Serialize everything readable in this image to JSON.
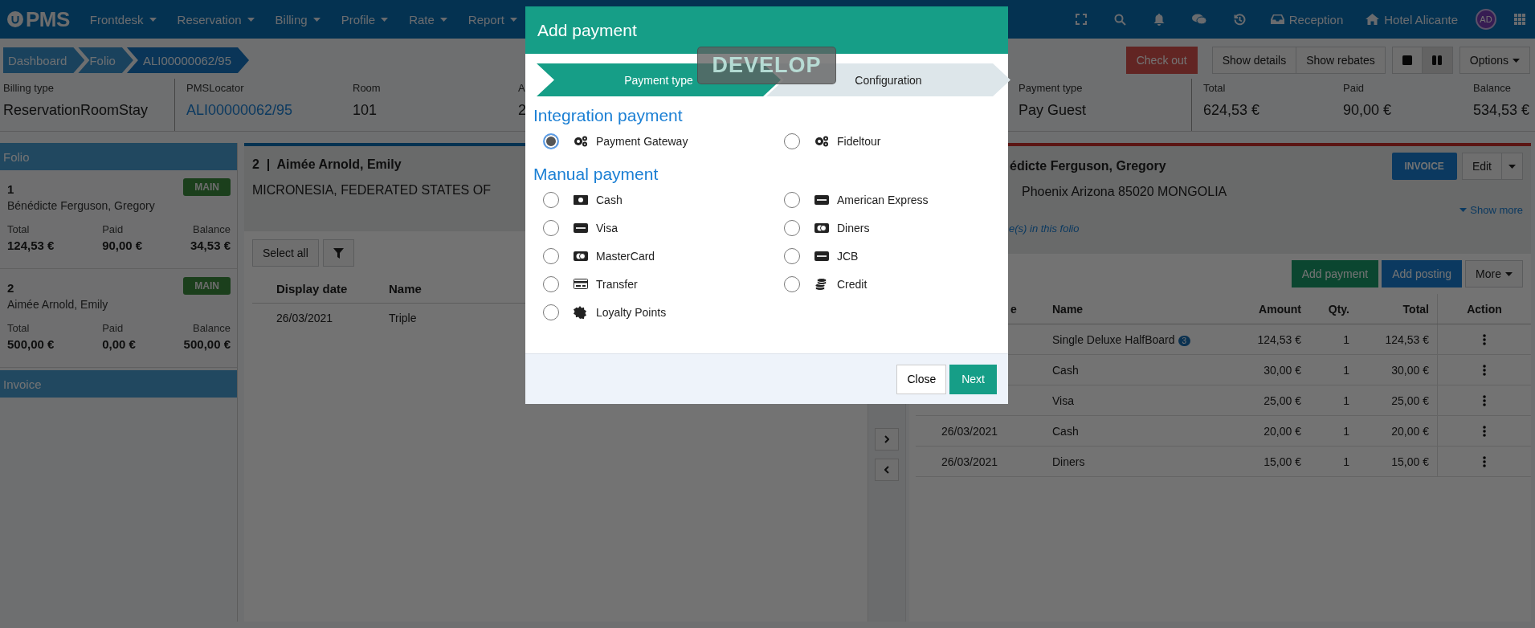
{
  "navbar": {
    "logo": "PMS",
    "menus": [
      "Frontdesk",
      "Reservation",
      "Billing",
      "Profile",
      "Rate",
      "Report"
    ],
    "reception": "Reception",
    "hotel": "Hotel Alicante",
    "avatar": "AD"
  },
  "breadcrumb": [
    {
      "label": "Dashboard",
      "selected": false
    },
    {
      "label": "Folio",
      "selected": false
    },
    {
      "label": "ALI00000062/95",
      "selected": true
    }
  ],
  "actions": {
    "check_out": "Check out",
    "details": [
      "Show details",
      "Show rebates"
    ],
    "views": [
      {
        "kind": "single",
        "selected": false
      },
      {
        "kind": "split",
        "selected": true
      }
    ],
    "options": "Options"
  },
  "summary": {
    "left": [
      {
        "label": "Billing type",
        "value": "ReservationRoomStay",
        "kind": "text"
      },
      {
        "label": "PMSLocator",
        "value": "ALI00000062/95",
        "kind": "link"
      },
      {
        "label": "Room",
        "value": "101",
        "kind": "text"
      },
      {
        "label": "A",
        "value": "2",
        "kind": "text"
      }
    ],
    "right": [
      {
        "label": "Payment type",
        "value": "Pay Guest",
        "kind": "text"
      },
      {
        "label": "Total",
        "value": "624,53 €",
        "kind": "text"
      },
      {
        "label": "Paid",
        "value": "90,00 €",
        "kind": "text"
      },
      {
        "label": "Balance",
        "value": "534,53 €",
        "kind": "text"
      }
    ]
  },
  "sidebar": {
    "title": "Folio",
    "folios": [
      {
        "number": "1",
        "name": "Bénédicte Ferguson, Gregory",
        "badge": "MAIN",
        "totals": [
          {
            "label": "Total",
            "value": "124,53 €"
          },
          {
            "label": "Paid",
            "value": "90,00 €"
          },
          {
            "label": "Balance",
            "value": "34,53 €"
          }
        ]
      },
      {
        "number": "2",
        "name": "Aimée Arnold, Emily",
        "badge": "MAIN",
        "totals": [
          {
            "label": "Total",
            "value": "500,00 €"
          },
          {
            "label": "Paid",
            "value": "0,00 €"
          },
          {
            "label": "Balance",
            "value": "500,00 €"
          }
        ]
      }
    ],
    "invoice": "Invoice"
  },
  "middle": {
    "heading": "2  |  Aimée Arnold, Emily",
    "address": "MICRONESIA, FEDERATED STATES OF",
    "select_all": "Select all",
    "columns": [
      "Display date",
      "Name"
    ],
    "rows": [
      [
        "26/03/2021",
        "Triple"
      ]
    ]
  },
  "right": {
    "heading": "édicte Ferguson, Gregory",
    "address": "Phoenix Arizona 85020 MONGOLIA",
    "show_more": "Show more",
    "note": "e(s) in this folio",
    "invoice": "INVOICE",
    "edit": "Edit",
    "add_payment": "Add payment",
    "add_posting": "Add posting",
    "more": "More",
    "columns": [
      "e",
      "Name",
      "Amount",
      "Qty.",
      "Total",
      "Action"
    ],
    "rows": [
      {
        "name": "Single Deluxe HalfBoard",
        "count": "3",
        "amount": "124,53 €",
        "qty": "1",
        "total": "124,53 €"
      },
      {
        "name": "Cash",
        "amount": "30,00 €",
        "qty": "1",
        "total": "30,00 €"
      },
      {
        "name": "Visa",
        "amount": "25,00 €",
        "qty": "1",
        "total": "25,00 €"
      },
      {
        "date": "26/03/2021",
        "name": "Cash",
        "amount": "20,00 €",
        "qty": "1",
        "total": "20,00 €"
      },
      {
        "date": "26/03/2021",
        "name": "Diners",
        "amount": "15,00 €",
        "qty": "1",
        "total": "15,00 €"
      }
    ]
  },
  "modal": {
    "title": "Add payment",
    "env_badge": "DEVELOP",
    "steps": [
      {
        "label": "Payment type",
        "selected": true
      },
      {
        "label": "Configuration",
        "selected": false
      }
    ],
    "sections": [
      {
        "heading": "Integration payment",
        "options": [
          {
            "label": "Payment Gateway",
            "kind": "gears",
            "selected": true
          },
          {
            "label": "Fideltour",
            "kind": "gears",
            "selected": false
          }
        ]
      },
      {
        "heading": "Manual payment",
        "options": [
          {
            "label": "Cash",
            "kind": "banknote",
            "selected": false
          },
          {
            "label": "American Express",
            "kind": "card",
            "selected": false
          },
          {
            "label": "Visa",
            "kind": "card",
            "selected": false
          },
          {
            "label": "Diners",
            "kind": "card-rings",
            "selected": false
          },
          {
            "label": "MasterCard",
            "kind": "card-rings",
            "selected": false
          },
          {
            "label": "JCB",
            "kind": "card",
            "selected": false
          },
          {
            "label": "Transfer",
            "kind": "card-stripe",
            "selected": false
          },
          {
            "label": "Credit",
            "kind": "coins",
            "selected": false
          },
          {
            "label": "Loyalty Points",
            "kind": "seal",
            "selected": false
          }
        ]
      }
    ],
    "close": "Close",
    "next": "Next"
  }
}
